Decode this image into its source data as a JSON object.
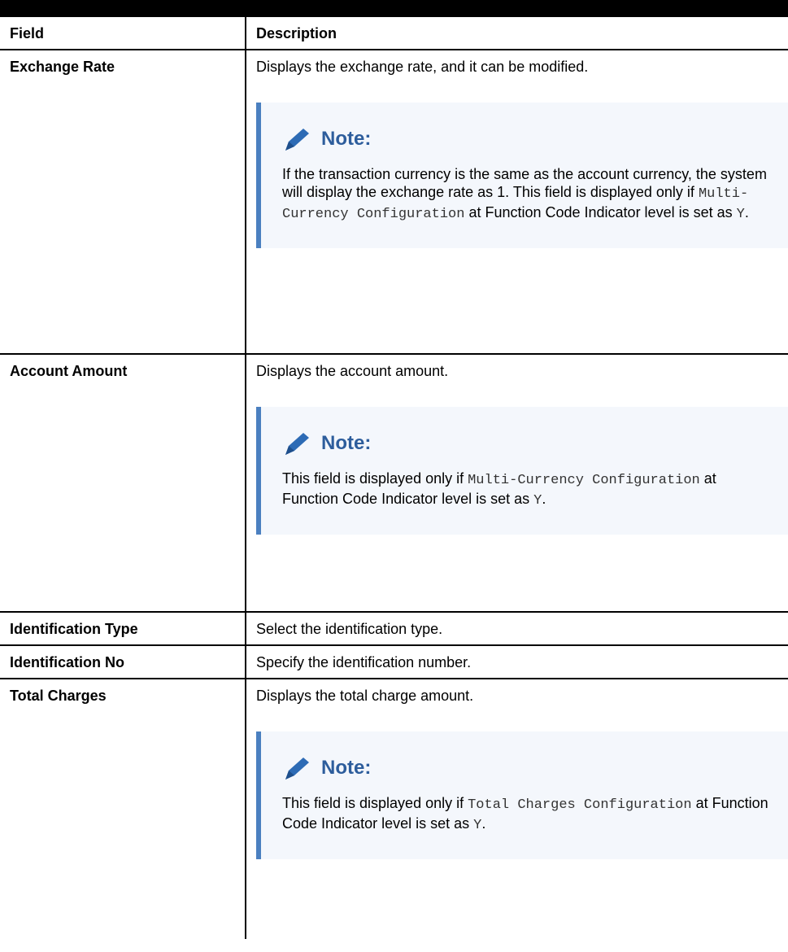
{
  "table": {
    "header": {
      "field": "Field",
      "description": "Description"
    },
    "rows": [
      {
        "field": "Exchange Rate",
        "description": "Displays the exchange rate, and it can be modified.",
        "note": {
          "title": "Note:",
          "t1": "If the transaction currency is the same as the account currency, the system will display the exchange rate as 1. This field is displayed only if ",
          "c1": "Multi-Currency Configuration",
          "t2": " at Function Code Indicator level is set as ",
          "c2": "Y",
          "t3": "."
        }
      },
      {
        "field": "Account Amount",
        "description": "Displays the account amount.",
        "note": {
          "title": "Note:",
          "t1": "This field is displayed only if ",
          "c1": "Multi-Currency Configuration",
          "t2": " at Function Code Indicator level is set as ",
          "c2": "Y",
          "t3": "."
        }
      },
      {
        "field": "Identification Type",
        "description": "Select the identification type."
      },
      {
        "field": "Identification No",
        "description": "Specify the identification number."
      },
      {
        "field": "Total Charges",
        "description": "Displays the total charge amount.",
        "note": {
          "title": "Note:",
          "t1": "This field is displayed only if ",
          "c1": "Total Charges Configuration",
          "t2": " at Function Code Indicator level is set as ",
          "c2": "Y",
          "t3": "."
        }
      }
    ]
  },
  "colors": {
    "note_accent": "#4b80c0",
    "note_background": "#f4f7fc",
    "note_title": "#2d5d9c"
  },
  "icons": {
    "note": "pencil-icon"
  }
}
